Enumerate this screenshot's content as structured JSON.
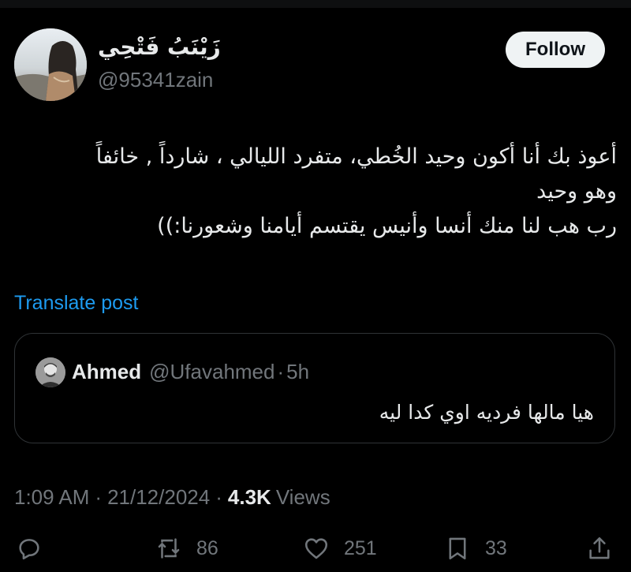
{
  "user": {
    "display_name": "زَيْنَبُ فَتْحِي",
    "handle": "@95341zain",
    "follow_label": "Follow"
  },
  "tweet": {
    "lines": [
      "أعوذ بك أنا أكون وحيد الخُطي، متفرد الليالي ، شارداً , خائفاً",
      "وهو وحيد",
      "رب هب لنا منك أنسا وأنيس يقتسم أيامنا وشعورنا:))"
    ],
    "translate_label": "Translate post"
  },
  "quote": {
    "name": "Ahmed",
    "handle": "@Ufavahmed",
    "separator": "·",
    "time": "5h",
    "text": "هيا مالها فرديه اوي كدا ليه"
  },
  "meta": {
    "time": "1:09 AM",
    "separator": "·",
    "date": "21/12/2024",
    "views_count": "4.3K",
    "views_label": "Views"
  },
  "actions": {
    "reply_icon": "reply-icon",
    "retweet_icon": "retweet-icon",
    "retweet_count": "86",
    "like_icon": "heart-icon",
    "like_count": "251",
    "bookmark_icon": "bookmark-icon",
    "bookmark_count": "33",
    "share_icon": "share-icon"
  },
  "colors": {
    "background": "#000000",
    "text": "#e7e9ea",
    "muted": "#71767b",
    "link": "#1d9bf0",
    "border": "#2f3336",
    "button_bg": "#eff3f4"
  }
}
